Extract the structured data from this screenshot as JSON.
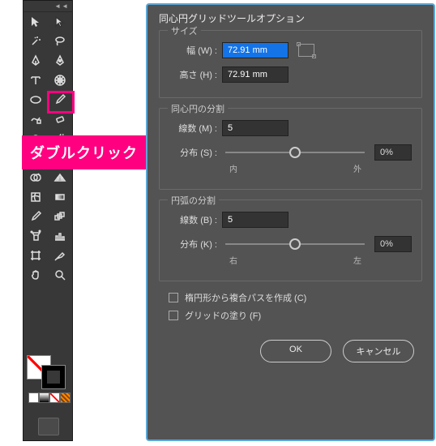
{
  "callout": "ダブルクリック",
  "dialog": {
    "title": "同心円グリッドツールオプション",
    "size": {
      "title": "サイズ",
      "width_label": "幅 (W) :",
      "width_value": "72.91 mm",
      "height_label": "高さ (H) :",
      "height_value": "72.91 mm"
    },
    "concentric": {
      "title": "同心円の分割",
      "count_label": "線数 (M) :",
      "count_value": "5",
      "skew_label": "分布 (S) :",
      "skew_value": "0%",
      "skew_left": "内",
      "skew_right": "外"
    },
    "radial": {
      "title": "円弧の分割",
      "count_label": "線数 (B) :",
      "count_value": "5",
      "skew_label": "分布 (K) :",
      "skew_value": "0%",
      "skew_left": "右",
      "skew_right": "左"
    },
    "compound_label": "楕円形から複合パスを作成 (C)",
    "fill_label": "グリッドの塗り (F)",
    "ok": "OK",
    "cancel": "キャンセル"
  },
  "tools": {
    "header": "◄◄"
  }
}
